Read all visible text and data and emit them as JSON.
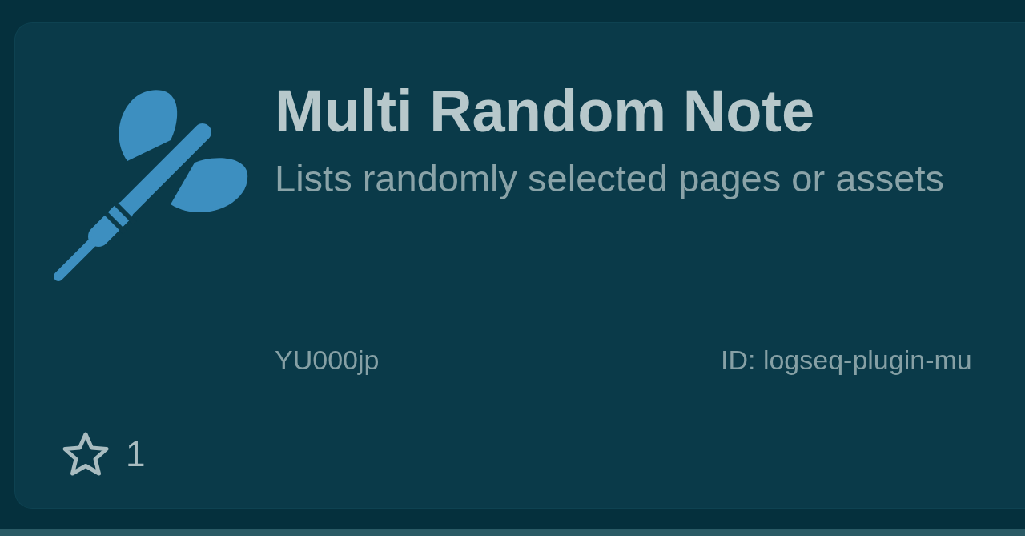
{
  "plugin_card": {
    "title": "Multi Random Note",
    "description": "Lists randomly selected pages or assets",
    "author": "YU000jp",
    "id_text": "ID: logseq-plugin-mu",
    "star_count": "1"
  }
}
